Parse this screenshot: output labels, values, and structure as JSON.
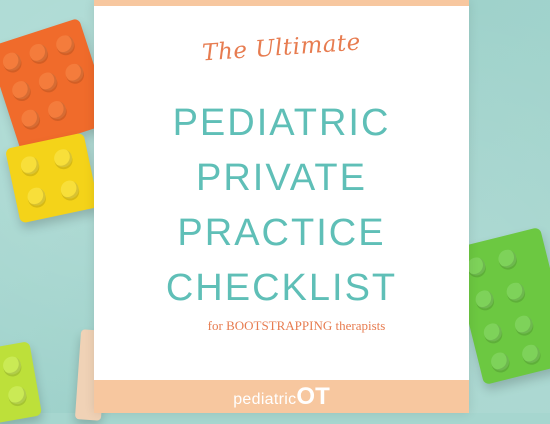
{
  "cover": {
    "eyebrow": "The Ultimate",
    "title_lines": [
      "PEDIATRIC",
      "PRIVATE",
      "PRACTICE",
      "CHECKLIST"
    ],
    "subtitle": "for BOOTSTRAPPING therapists"
  },
  "logo": {
    "part1": "pediatric",
    "part2": "OT"
  },
  "colors": {
    "background": "#a6d6cf",
    "title": "#5fbfb7",
    "accent": "#e77c50",
    "band": "#f7c79f",
    "brick_orange": "#f06b2b",
    "brick_yellow": "#f4d319",
    "brick_green": "#6cc841",
    "brick_lime": "#bde03a"
  }
}
